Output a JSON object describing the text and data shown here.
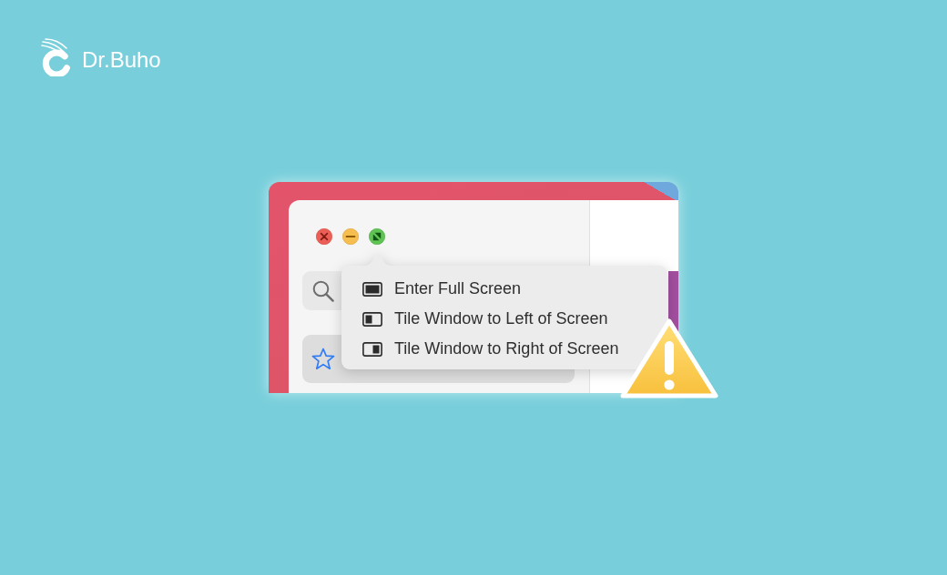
{
  "brand": {
    "name": "Dr.Buho"
  },
  "window": {
    "zoom_menu": {
      "items": [
        {
          "label": "Enter Full Screen",
          "kind": "full"
        },
        {
          "label": "Tile Window to Left of Screen",
          "kind": "left"
        },
        {
          "label": "Tile Window to Right of Screen",
          "kind": "right"
        }
      ]
    }
  }
}
